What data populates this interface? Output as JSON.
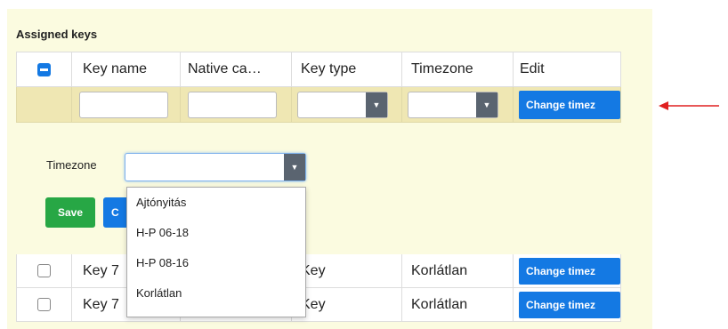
{
  "section": {
    "title": "Assigned keys"
  },
  "columns": [
    "Key name",
    "Native ca…",
    "Key type",
    "Timezone",
    "Edit"
  ],
  "filter_row": {
    "change_button": "Change timez"
  },
  "editor": {
    "timezone_label": "Timezone",
    "save_label": "Save",
    "cancel_label": "C",
    "timezone_options": [
      "Ajtónyitás",
      "H-P 06-18",
      "H-P 08-16",
      "Korlátlan"
    ]
  },
  "rows": [
    {
      "key_name": "Key 7",
      "native": "",
      "key_type": "Key",
      "timezone": "Korlátlan",
      "edit": "Change timez"
    },
    {
      "key_name": "Key 7",
      "native": "",
      "key_type": "Key",
      "timezone": "Korlátlan",
      "edit": "Change timez"
    }
  ],
  "colors": {
    "accent": "#1479e3",
    "save": "#27a745",
    "panel": "#fbfbe0",
    "filter": "#efe7b3",
    "annotation": "#e02020"
  },
  "icons": {
    "header_check": "minus-checkbox-icon",
    "dropdown": "caret-down-icon",
    "annotation": "left-arrow-icon"
  }
}
